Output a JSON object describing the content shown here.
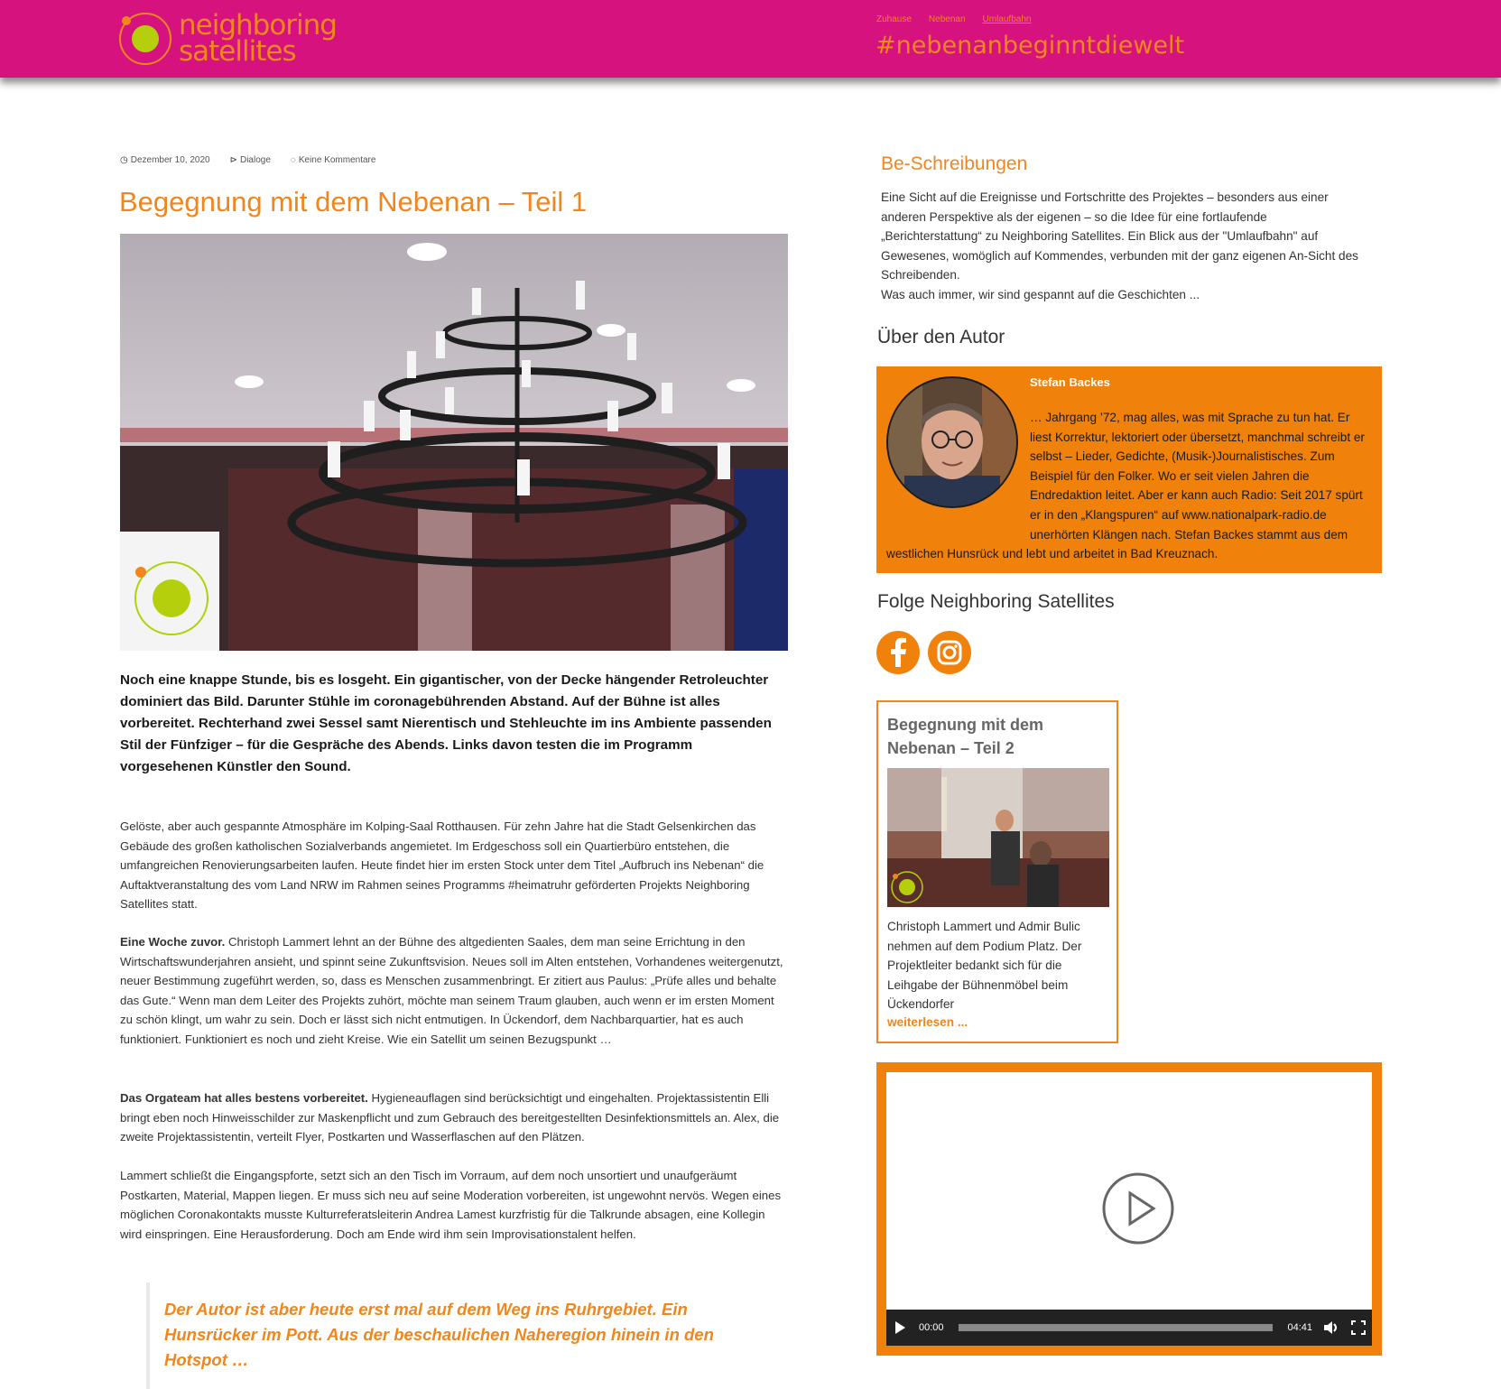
{
  "header": {
    "logo_line1": "neighboring",
    "logo_line2": "satellites",
    "nav": [
      "Zuhause",
      "Nebenan",
      "Umlaufbahn"
    ],
    "active_nav": "Umlaufbahn",
    "hashtag": "#nebenanbeginntdiewelt"
  },
  "post": {
    "date": "Dezember 10, 2020",
    "category": "Dialoge",
    "comments": "Keine Kommentare",
    "title": "Begegnung mit dem Nebenan – Teil 1",
    "lead": "Noch eine knappe Stunde, bis es losgeht. Ein gigantischer, von der Decke hängender Retroleuchter dominiert das Bild. Darunter Stühle im coronagebührenden Abstand. Auf der Bühne ist alles vorbereitet. Rechterhand zwei Sessel samt Nierentisch und Stehleuchte im ins Ambiente passenden Stil der Fünfziger – für die Gespräche des Abends. Links davon testen die im Programm vorgesehenen Künstler den Sound.",
    "p1": "Gelöste, aber auch gespannte Atmosphäre im Kolping-Saal Rotthausen. Für zehn Jahre hat die Stadt Gelsenkirchen das Gebäude des großen katholischen Sozialverbands angemietet. Im Erdgeschoss soll ein Quartierbüro entstehen, die umfangreichen Renovierungsarbeiten laufen. Heute findet hier im ersten Stock unter dem Titel „Aufbruch ins Nebenan“ die Auftaktveranstaltung des vom Land NRW im Rahmen seines Programms #heimatruhr geförderten Projekts Neighboring Satellites statt.",
    "p2_bold": "Eine Woche zuvor.",
    "p2": " Christoph Lammert lehnt an der Bühne des altgedienten Saales, dem man seine Errichtung in den Wirtschaftswunderjahren ansieht, und spinnt seine Zukunftsvision. Neues soll im Alten entstehen, Vorhandenes weitergenutzt, neuer Bestimmung zugeführt werden, so, dass es Menschen zusammenbringt. Er zitiert aus Paulus: „Prüfe alles und behalte das Gute.“ Wenn man dem Leiter des Projekts zuhört, möchte man seinem Traum glauben, auch wenn er im ersten Moment zu schön klingt, um wahr zu sein. Doch er lässt sich nicht entmutigen. In Ückendorf, dem Nachbarquartier, hat es auch funktioniert. Funktioniert es noch und zieht Kreise. Wie ein Satellit um seinen Bezugspunkt …",
    "p3_bold": "Das Orgateam hat alles bestens vorbereitet.",
    "p3": " Hygieneauflagen sind berücksichtigt und eingehalten. Projektassistentin Elli bringt eben noch Hinweisschilder zur Maskenpflicht und zum Gebrauch des bereitgestellten Desinfektionsmittels an. Alex, die zweite Projektassistentin, verteilt Flyer, Postkarten und Wasserflaschen auf den Plätzen.",
    "p4": "Lammert schließt die Eingangspforte, setzt sich an den Tisch im Vorraum, auf dem noch unsortiert und unaufgeräumt Postkarten, Material, Mappen liegen. Er muss sich neu auf seine Moderation vorbereiten, ist ungewohnt nervös. Wegen eines möglichen Coronakontakts musste Kulturreferatsleiterin Andrea Lamest kurzfristig für die Talkrunde absagen, eine Kollegin wird einspringen. Eine Herausforderung. Doch am Ende wird ihm sein Improvisationstalent helfen.",
    "quote": "Der Autor ist aber heute erst mal auf dem Weg ins Ruhrgebiet. Ein Hunsrücker im Pott. Aus der beschaulichen Naheregion hinein in den Hotspot …"
  },
  "sidebar": {
    "be_title": "Be-Schreibungen",
    "be_text": "Eine Sicht auf die Ereignisse und Fortschritte des Projektes – besonders aus einer anderen Perspektive als der eigenen – so die Idee für eine fortlaufende „Berichterstattung“ zu Neighboring Satellites. Ein Blick aus der \"Umlaufbahn\" auf Gewesenes, womöglich auf Kommendes, verbunden mit der ganz eigenen An-Sicht des Schreibenden.",
    "be_text2": "Was auch immer, wir sind gespannt auf die Geschichten ...",
    "ueber_title": "Über den Autor",
    "author_name": "Stefan Backes",
    "author_bio": "… Jahrgang ’72, mag alles, was mit Sprache zu tun hat. Er liest Korrektur, lektoriert oder übersetzt, manchmal schreibt er selbst – Lieder, Gedichte, (Musik-)Journalistisches. Zum Beispiel für den Folker. Wo er seit vielen Jahren die Endredaktion leitet. Aber er kann auch Radio: Seit 2017 spürt er in den „Klangspuren“ auf www.nationalpark-radio.de unerhörten Klängen nach. Stefan Backes stammt aus dem westlichen Hunsrück und lebt und arbeitet in Bad Kreuznach.",
    "folge_title": "Folge Neighboring Satellites",
    "social": [
      "facebook-icon",
      "instagram-icon"
    ],
    "card_title": "Begegnung mit dem Nebenan – Teil 2",
    "card_text": "Christoph Lammert und Admir Bulic nehmen auf dem Podium Platz. Der Projektleiter bedankt sich für die Leihgabe der Bühnenmöbel beim Ückendorfer",
    "card_more": "weiterlesen ...",
    "video_current": "00:00",
    "video_duration": "04:41"
  },
  "colors": {
    "header_bg": "#d6127e",
    "accent": "#f0861e",
    "lime": "#b5cf0c"
  }
}
